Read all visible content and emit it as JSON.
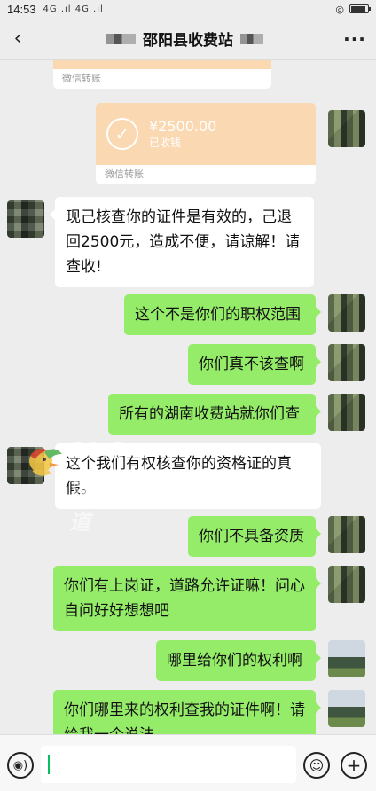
{
  "status": {
    "time": "14:53",
    "signal": "4G .ıl 4G .ıl",
    "icons": [
      "alarm-icon",
      "battery-icon"
    ]
  },
  "header": {
    "back_icon": "chevron-left-icon",
    "title": "邵阳县收费站",
    "more": "···"
  },
  "messages": {
    "transfer_prev_foot": "微信转账",
    "transfer": {
      "amount": "¥2500.00",
      "status": "已收钱",
      "foot": "微信转账"
    },
    "m1": "现己核查你的证件是有效的，己退回2500元，造成不便，请谅解！请查收!",
    "m2": "这个不是你们的职权范围",
    "m3": "你们真不该查啊",
    "m4": "所有的湖南收费站就你们查",
    "m5": "这个我们有权核查你的资格证的真假。",
    "m6": "你们不具备资质",
    "m7": "你们有上岗证，道路允许证嘛！问心自问好好想想吧",
    "m8": "哪里给你们的权利啊",
    "m9": "你们哪里来的权利查我的证件啊！请给我一个说法"
  },
  "watermark": {
    "number": "91.8",
    "fm": "fm",
    "text": "湖南交通频道"
  },
  "input": {
    "placeholder": "",
    "voice_icon": "voice-icon",
    "emoji_icon": "emoji-icon",
    "plus_icon": "plus-icon"
  },
  "colors": {
    "bubble_green": "#95ec69",
    "bubble_white": "#ffffff",
    "transfer": "#fad8b1",
    "background": "#ededed"
  }
}
